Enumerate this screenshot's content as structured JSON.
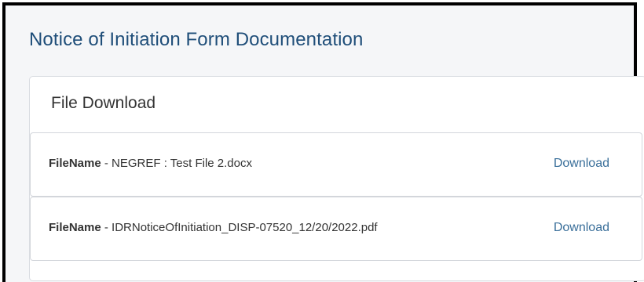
{
  "page": {
    "title": "Notice of Initiation Form Documentation"
  },
  "file_download": {
    "header": "File Download",
    "files": [
      {
        "key_label": "FileName",
        "separator": " - ",
        "name": "NEGREF : Test File 2.docx",
        "action_label": "Download"
      },
      {
        "key_label": "FileName",
        "separator": " - ",
        "name": "IDRNoticeOfInitiation_DISP-07520_12/20/2022.pdf",
        "action_label": "Download"
      }
    ]
  },
  "colors": {
    "title": "#1f4e79",
    "link": "#3a6f9a",
    "frame_border": "#000000",
    "background": "#f5f6f8"
  }
}
